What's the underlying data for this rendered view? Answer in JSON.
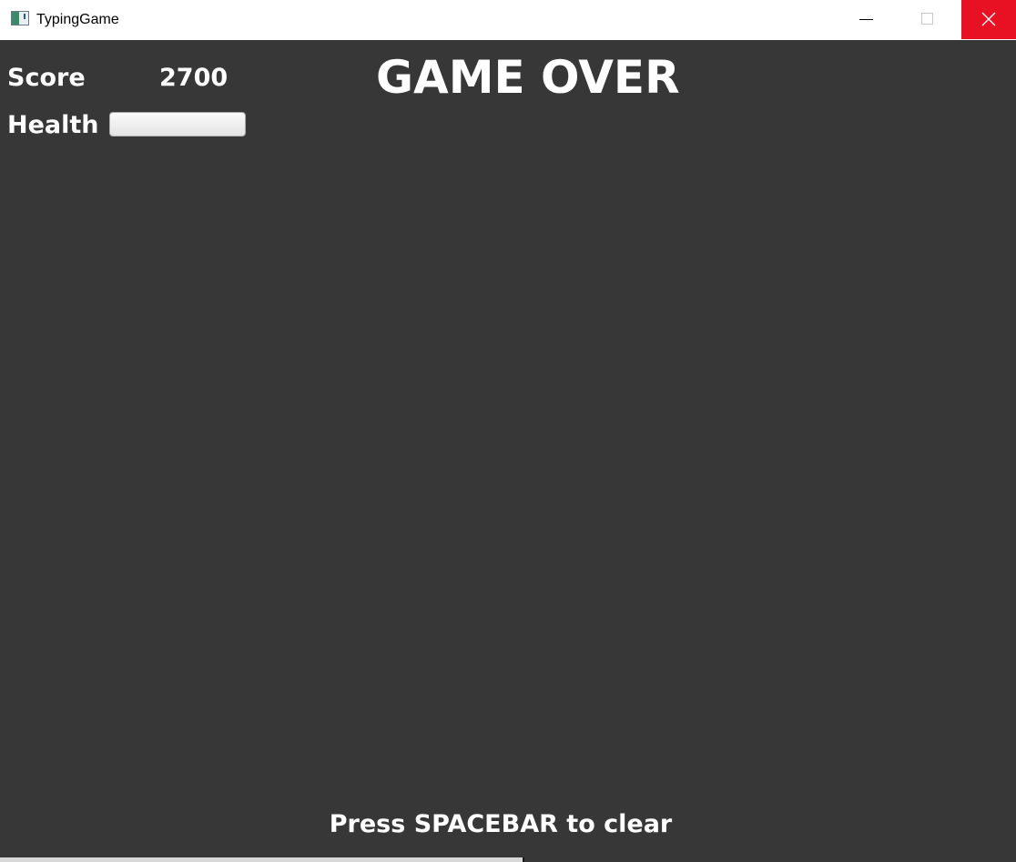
{
  "window": {
    "title": "TypingGame",
    "icon": "app-window-icon",
    "controls": {
      "minimize_icon": "minimize-icon",
      "maximize_icon": "maximize-icon",
      "close_icon": "close-icon",
      "close_color": "#e81123"
    }
  },
  "hud": {
    "score_label": "Score",
    "score_value": "2700",
    "health_label": "Health",
    "health_fraction": 0
  },
  "game": {
    "status": "GAME OVER",
    "hint": "Press SPACEBAR to clear"
  },
  "colors": {
    "background": "#373737",
    "text": "#ffffff"
  }
}
